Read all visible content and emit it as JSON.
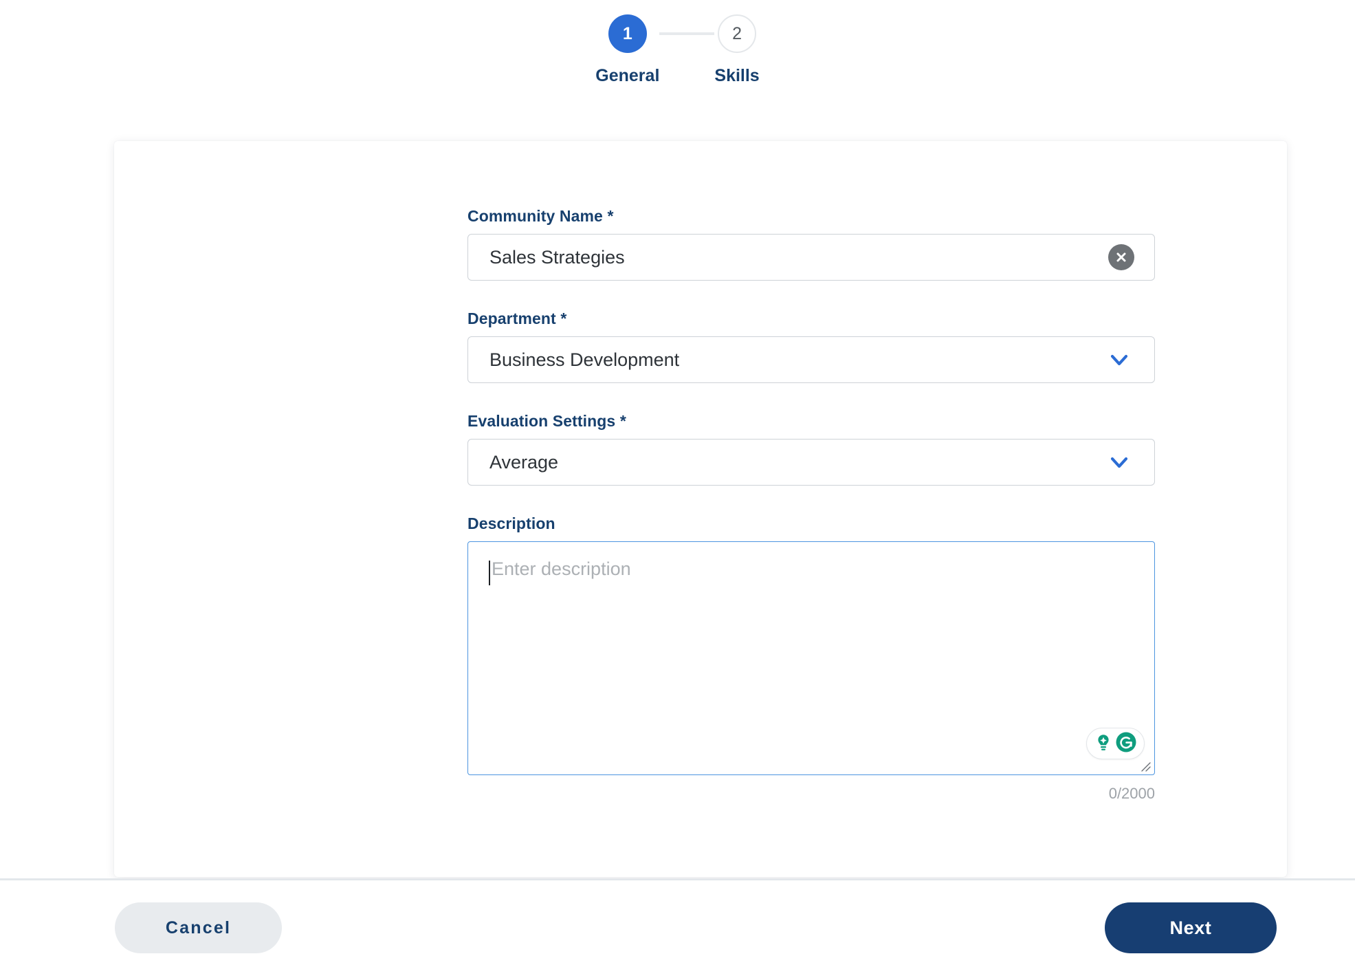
{
  "stepper": {
    "steps": [
      {
        "number": "1",
        "label": "General",
        "state": "active"
      },
      {
        "number": "2",
        "label": "Skills",
        "state": "inactive"
      }
    ]
  },
  "form": {
    "community_name": {
      "label": "Community Name",
      "required_marker": "*",
      "value": "Sales Strategies",
      "clear_icon": "close-circle-icon"
    },
    "department": {
      "label": "Department",
      "required_marker": "*",
      "value": "Business Development",
      "dropdown_icon": "chevron-down-icon"
    },
    "evaluation_settings": {
      "label": "Evaluation Settings",
      "required_marker": "*",
      "value": "Average",
      "dropdown_icon": "chevron-down-icon"
    },
    "description": {
      "label": "Description",
      "value": "",
      "placeholder": "Enter description",
      "counter": "0/2000",
      "assistant_icons": [
        "lightbulb-icon",
        "grammarly-icon"
      ],
      "resize_handle": "resize-grip-icon"
    }
  },
  "footer": {
    "cancel_label": "Cancel",
    "next_label": "Next"
  },
  "colors": {
    "accent_blue": "#2b6cd4",
    "label_navy": "#17406e",
    "primary_button": "#173e72",
    "cancel_button": "#e8ebee",
    "focus_border": "#4b94e0",
    "grammarly_green": "#0f9d7e"
  }
}
